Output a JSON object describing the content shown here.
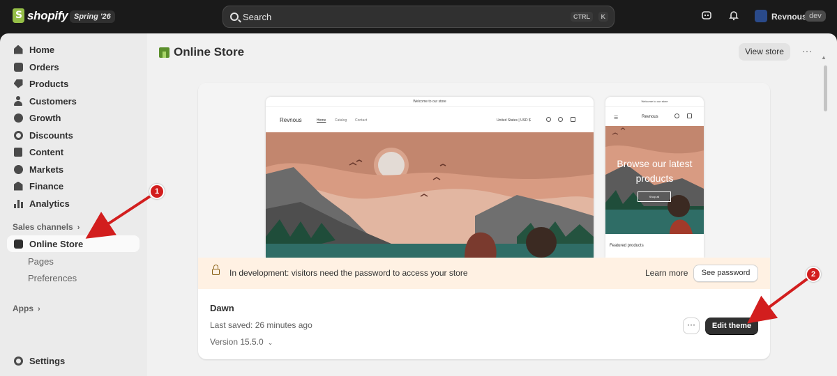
{
  "topbar": {
    "logo_text": "shopify",
    "edition": "Spring '26",
    "search_placeholder": "Search",
    "kbd_ctrl": "CTRL",
    "kbd_k": "K",
    "user_name": "Revnous",
    "user_badge": "dev"
  },
  "sidebar": {
    "items": [
      {
        "label": "Home",
        "icon": "home-icon"
      },
      {
        "label": "Orders",
        "icon": "orders-icon"
      },
      {
        "label": "Products",
        "icon": "tag-icon"
      },
      {
        "label": "Customers",
        "icon": "person-icon"
      },
      {
        "label": "Growth",
        "icon": "growth-icon"
      },
      {
        "label": "Discounts",
        "icon": "discount-icon"
      },
      {
        "label": "Content",
        "icon": "content-icon"
      },
      {
        "label": "Markets",
        "icon": "globe-icon"
      },
      {
        "label": "Finance",
        "icon": "bank-icon"
      },
      {
        "label": "Analytics",
        "icon": "bar-chart-icon"
      }
    ],
    "sales_channels_label": "Sales channels",
    "online_store_label": "Online Store",
    "sub_items": [
      "Pages",
      "Preferences"
    ],
    "apps_label": "Apps",
    "settings_label": "Settings"
  },
  "main": {
    "page_title": "Online Store",
    "view_store_label": "View store",
    "more_label": "···",
    "preview": {
      "desktop": {
        "announcement": "Welcome to our store",
        "brand": "Revnous",
        "nav": [
          "Home",
          "Catalog",
          "Contact"
        ],
        "currency": "United States | USD $"
      },
      "mobile": {
        "announcement": "Welcome to our store",
        "brand": "Revnous",
        "headline": "Browse our latest products",
        "button": "Shop all",
        "featured": "Featured products"
      }
    },
    "banner": {
      "text": "In development: visitors need the password to access your store",
      "learn_more": "Learn more",
      "see_password": "See password"
    },
    "theme": {
      "name": "Dawn",
      "last_saved": "Last saved: 26 minutes ago",
      "version": "Version 15.5.0",
      "more_label": "···",
      "edit_label": "Edit theme"
    }
  },
  "annotations": {
    "step1": "1",
    "step2": "2"
  },
  "colors": {
    "topbar": "#1a1a1a",
    "annotation_red": "#d21e1e",
    "banner_bg": "#fff1e3",
    "primary_button": "#303030"
  }
}
